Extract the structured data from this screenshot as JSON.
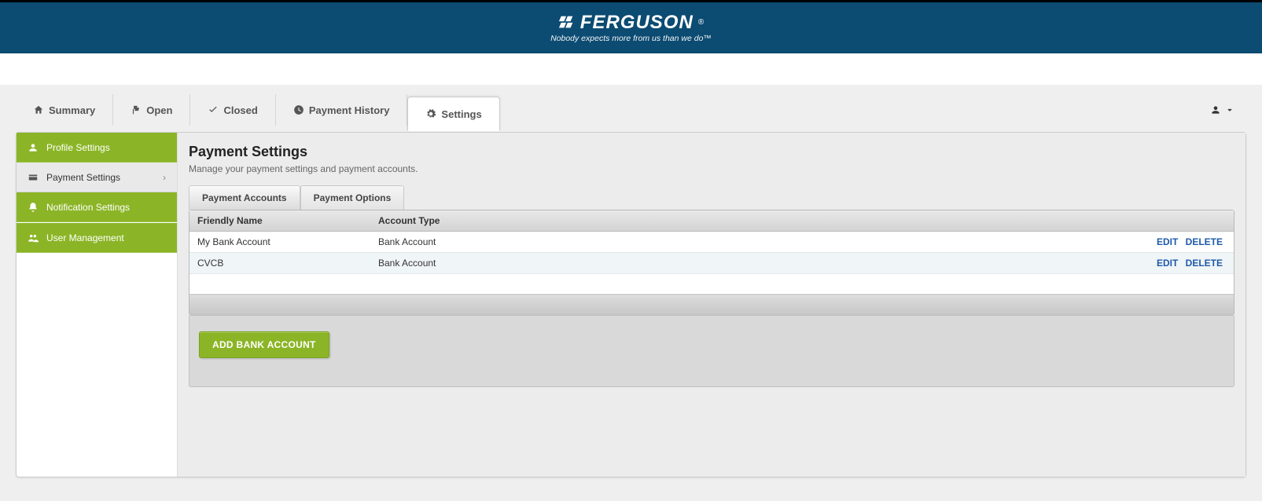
{
  "brand": {
    "name": "FERGUSON",
    "tagline": "Nobody expects more from us than we do™",
    "reg": "®"
  },
  "tabs": {
    "summary": "Summary",
    "open": "Open",
    "closed": "Closed",
    "payment_history": "Payment History",
    "settings": "Settings"
  },
  "sidebar": {
    "profile": "Profile Settings",
    "payment": "Payment Settings",
    "notification": "Notification Settings",
    "user_mgmt": "User Management"
  },
  "page": {
    "title": "Payment Settings",
    "subtitle": "Manage your payment settings and payment accounts."
  },
  "subtabs": {
    "accounts": "Payment Accounts",
    "options": "Payment Options"
  },
  "table": {
    "headers": {
      "friendly": "Friendly Name",
      "type": "Account Type"
    },
    "rows": [
      {
        "friendly": "My Bank Account",
        "type": "Bank Account"
      },
      {
        "friendly": "CVCB",
        "type": "Bank Account"
      }
    ],
    "actions": {
      "edit": "EDIT",
      "delete": "DELETE"
    }
  },
  "buttons": {
    "add_bank": "ADD BANK ACCOUNT"
  }
}
